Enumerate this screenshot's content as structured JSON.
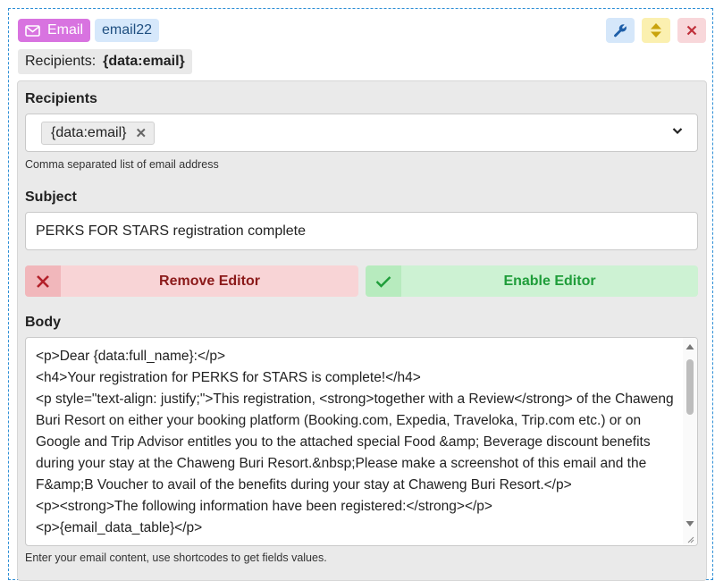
{
  "header": {
    "type_label": "Email",
    "type_icon": "envelope-icon",
    "name": "email22",
    "tools": [
      "wrench-icon",
      "move-updown-icon",
      "close-icon"
    ]
  },
  "summary": {
    "label": "Recipients:",
    "value": "{data:email}"
  },
  "recipients": {
    "label": "Recipients",
    "tag": "{data:email}",
    "hint": "Comma separated list of email address"
  },
  "subject": {
    "label": "Subject",
    "value": "PERKS FOR STARS registration complete"
  },
  "buttons": {
    "remove_editor": "Remove Editor",
    "enable_editor": "Enable Editor"
  },
  "body": {
    "label": "Body",
    "content": "<p>Dear {data:full_name}:</p>\n<h4>Your registration for PERKS for STARS is complete!</h4>\n<p style=\"text-align: justify;\">This registration, <strong>together with a Review</strong> of the Chaweng Buri Resort on either your booking platform (Booking.com, Expedia, Traveloka, Trip.com etc.) or on Google and Trip Advisor entitles you to the attached special Food &amp; Beverage discount benefits during your stay at the Chaweng Buri Resort.&nbsp;Please make a screenshot of this email and the F&amp;B Voucher to avail of the benefits during your stay at Chaweng Buri Resort.</p>\n<p><strong>The following information have been registered:</strong></p>\n<p>{email_data_table}</p>",
    "hint": "Enter your email content, use shortcodes to get fields values."
  },
  "colors": {
    "email_badge": "#d873e0",
    "name_badge": "#d6e8fb",
    "remove": "#f8d4d6",
    "enable": "#cdf2d3",
    "dashed_border": "#2e8fd6"
  }
}
